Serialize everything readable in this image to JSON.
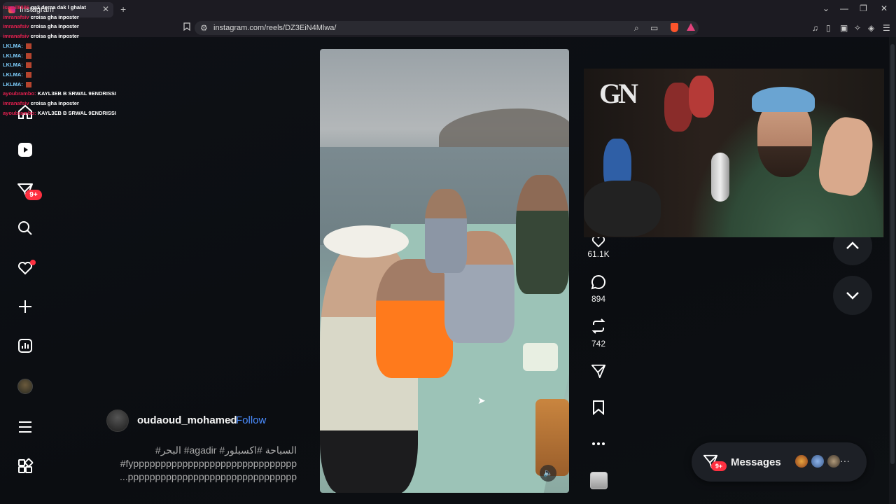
{
  "browser": {
    "tab_title": "Instagram",
    "tab_close": "✕",
    "new_tab": "+",
    "url": "instagram.com/reels/DZ3EiN4Mlwa/",
    "win_min": "⌄",
    "win_minimize": "—",
    "win_max": "❐",
    "win_close": "✕"
  },
  "chat": [
    {
      "user": "ismail8886",
      "msg": "ga3 derna dak l ghalat"
    },
    {
      "user": "imranafsiv",
      "msg": "croisa gha inposter"
    },
    {
      "user": "imranafsiv",
      "msg": "croisa gha inposter"
    },
    {
      "user": "imranafsiv",
      "msg": "croisa gha inposter"
    },
    {
      "user": "LKLMA:",
      "msg": ""
    },
    {
      "user": "LKLMA:",
      "msg": ""
    },
    {
      "user": "LKLMA:",
      "msg": ""
    },
    {
      "user": "LKLMA:",
      "msg": ""
    },
    {
      "user": "LKLMA:",
      "msg": ""
    },
    {
      "user": "ayoubrambo:",
      "msg": "KAYL3EB B SRWAL 9ENDRISSI"
    },
    {
      "user": "imranafsiv",
      "msg": "croisa gha inposter"
    },
    {
      "user": "ayoubrambo:",
      "msg": "KAYL3EB B SRWAL 9ENDRISSI"
    }
  ],
  "nav": {
    "notif_badge": "9+",
    "icons": [
      "instagram-home-icon",
      "reels-icon",
      "direct-icon",
      "search-icon",
      "heart-icon",
      "plus-icon",
      "insights-icon",
      "profile-avatar",
      "menu-icon",
      "apps-icon"
    ]
  },
  "post": {
    "author": "oudaoud_mohamed",
    "separator": "•",
    "follow": "Follow",
    "caption_line1": "#البحر #agadir #السباحة #اكسبلور",
    "caption_line2": "#fypppppppppppppppppppppppppppppp",
    "caption_line3": "...ppppppppppppppppppppppppppppppp",
    "likes": "61.1K",
    "comments": "894",
    "reposts": "742"
  },
  "messages": {
    "label": "Messages",
    "badge": "9+",
    "more": "···"
  },
  "colors": {
    "accent_follow": "#4a8cff",
    "badge_red": "#ff3040",
    "background": "#0c0d10"
  }
}
